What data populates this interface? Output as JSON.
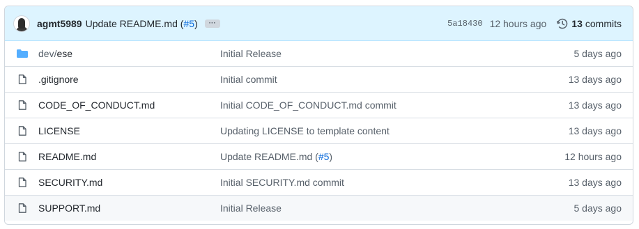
{
  "header": {
    "author": "agmt5989",
    "message_prefix": "Update README.md (",
    "message_link": "#5",
    "message_suffix": ")",
    "ellipsis": "···",
    "sha": "5a18430",
    "time": "12 hours ago",
    "commit_count": "13",
    "commits_label": "commits"
  },
  "files": [
    {
      "name_dir": "dev/",
      "name": "ese",
      "type": "folder",
      "message": "Initial Release",
      "time": "5 days ago"
    },
    {
      "name_dir": "",
      "name": ".gitignore",
      "type": "file",
      "message": "Initial commit",
      "time": "13 days ago"
    },
    {
      "name_dir": "",
      "name": "CODE_OF_CONDUCT.md",
      "type": "file",
      "message": "Initial CODE_OF_CONDUCT.md commit",
      "time": "13 days ago"
    },
    {
      "name_dir": "",
      "name": "LICENSE",
      "type": "file",
      "message": "Updating LICENSE to template content",
      "time": "13 days ago"
    },
    {
      "name_dir": "",
      "name": "README.md",
      "type": "file",
      "message_prefix": "Update README.md (",
      "message_link": "#5",
      "message_suffix": ")",
      "time": "12 hours ago"
    },
    {
      "name_dir": "",
      "name": "SECURITY.md",
      "type": "file",
      "message": "Initial SECURITY.md commit",
      "time": "13 days ago"
    },
    {
      "name_dir": "",
      "name": "SUPPORT.md",
      "type": "file",
      "message": "Initial Release",
      "time": "5 days ago"
    }
  ],
  "colors": {
    "header_bg": "#ddf4ff",
    "link": "#0969da",
    "folder": "#54aeff",
    "muted": "#57606a"
  }
}
